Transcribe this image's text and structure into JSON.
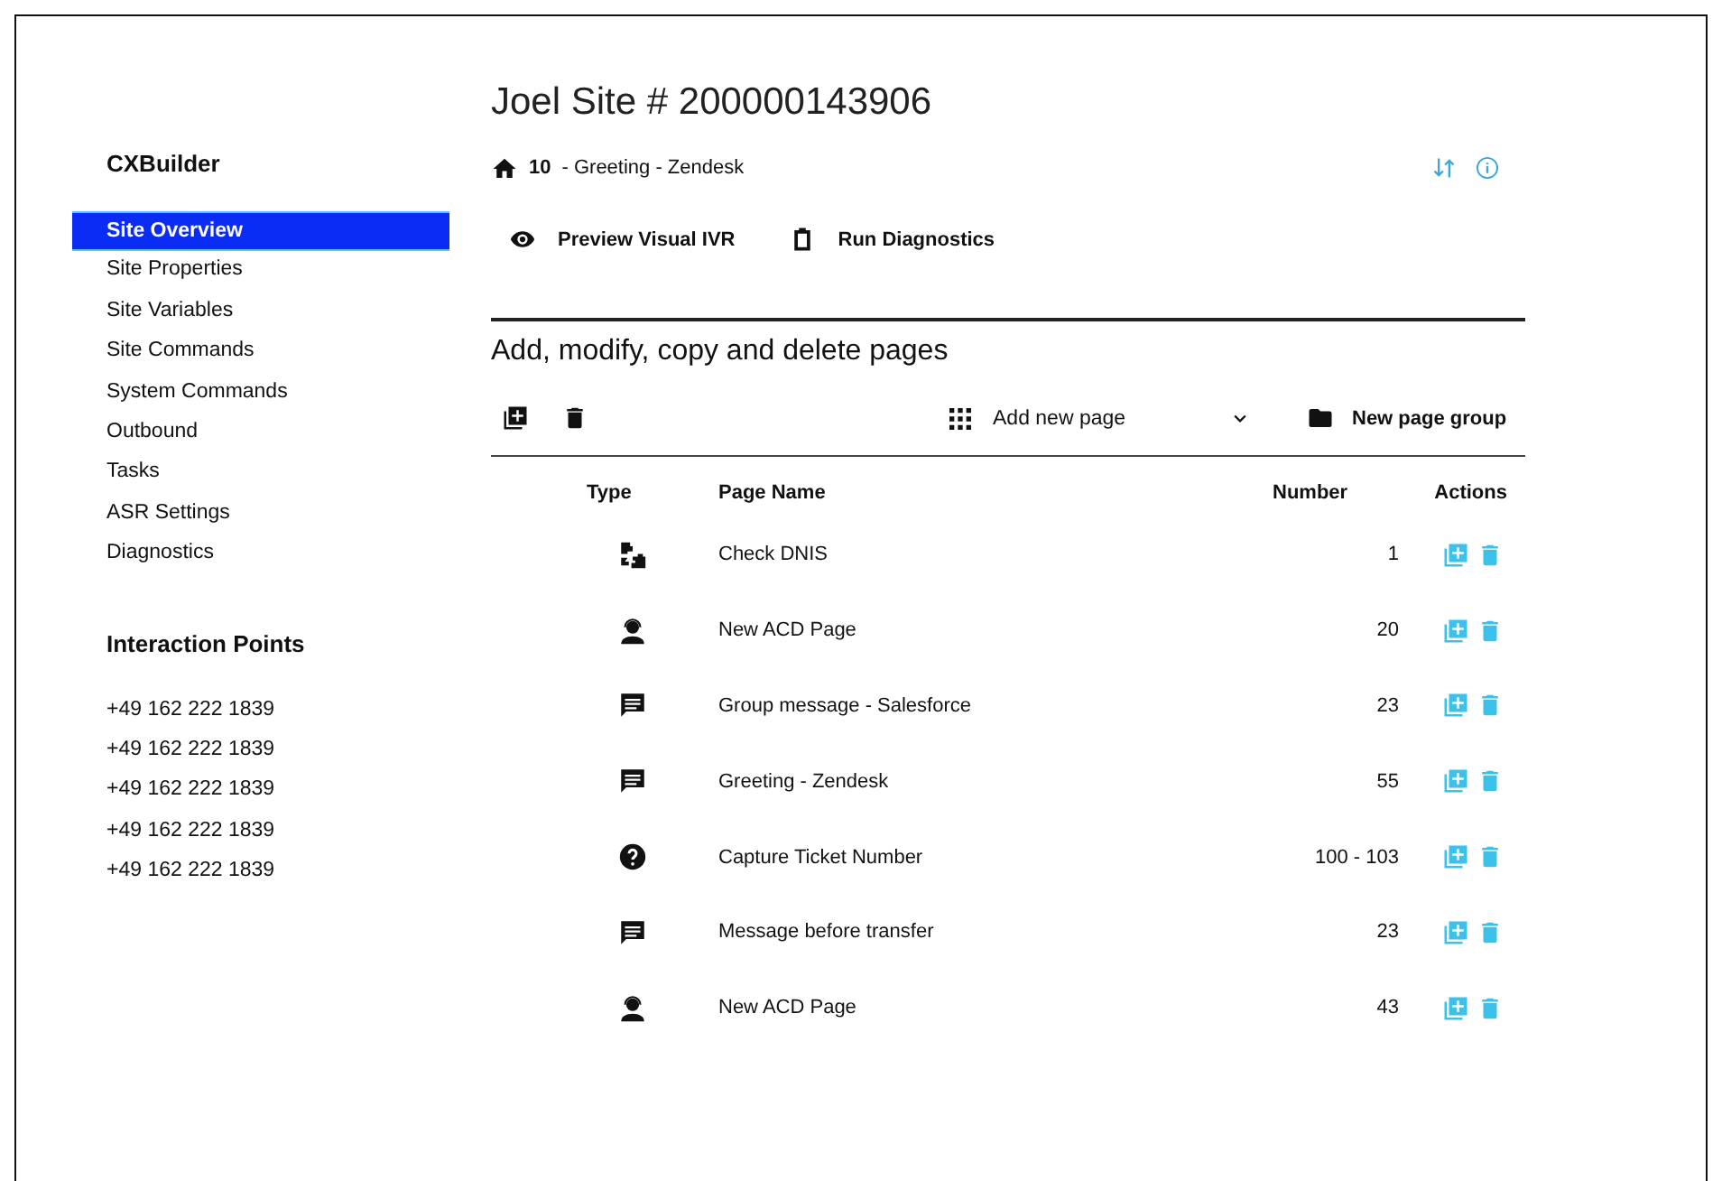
{
  "sidebar": {
    "title": "CXBuilder",
    "items": [
      {
        "label": "Site Overview",
        "selected": true
      },
      {
        "label": "Site Properties",
        "selected": false
      },
      {
        "label": "Site Variables",
        "selected": false
      },
      {
        "label": "Site Commands",
        "selected": false
      },
      {
        "label": "System Commands",
        "selected": false
      },
      {
        "label": "Outbound",
        "selected": false
      },
      {
        "label": "Tasks",
        "selected": false
      },
      {
        "label": "ASR Settings",
        "selected": false
      },
      {
        "label": "Diagnostics",
        "selected": false
      }
    ],
    "interaction_points": {
      "title": "Interaction Points",
      "numbers": [
        "+49 162 222 1839",
        "+49 162 222 1839",
        "+49 162 222 1839",
        "+49 162 222 1839",
        "+49 162 222 1839"
      ]
    }
  },
  "header": {
    "title": "Joel Site # 200000143906",
    "breadcrumb_number": "10",
    "breadcrumb_text": "- Greeting - Zendesk",
    "actions": [
      {
        "label": "Preview Visual IVR",
        "kind": "eye"
      },
      {
        "label": "Run Diagnostics",
        "kind": "clipboard"
      }
    ]
  },
  "pages": {
    "heading": "Add, modify, copy and delete pages",
    "add_page": "Add new page",
    "new_group": "New page group",
    "columns": [
      "Type",
      "Page Name",
      "Number",
      "Actions"
    ],
    "rows": [
      {
        "kind": "decision",
        "name": "Check DNIS",
        "number": "1"
      },
      {
        "kind": "agent",
        "name": "New ACD Page",
        "number": "20"
      },
      {
        "kind": "message",
        "name": "Group message - Salesforce",
        "number": "23"
      },
      {
        "kind": "message",
        "name": "Greeting - Zendesk",
        "number": "55"
      },
      {
        "kind": "question",
        "name": "Capture Ticket Number",
        "number": "100 - 103"
      },
      {
        "kind": "message",
        "name": "Message before transfer",
        "number": "23"
      },
      {
        "kind": "agent",
        "name": "New ACD Page",
        "number": "43"
      }
    ]
  }
}
